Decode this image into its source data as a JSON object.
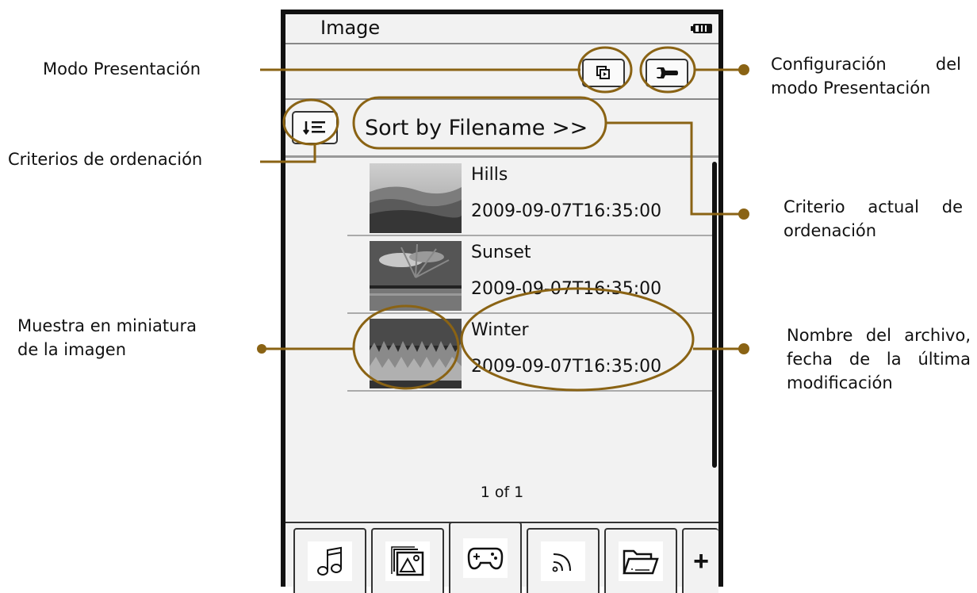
{
  "callouts": {
    "slideshow_mode": "Modo Presentación",
    "slideshow_config_line1": "Configuración del",
    "slideshow_config_line2": "modo Presentación",
    "sort_criteria": "Criterios de ordenación",
    "current_sort_line1": "Criterio actual de",
    "current_sort_line2": "ordenación",
    "thumbnail_line1": "Muestra en miniatura",
    "thumbnail_line2": "de la imagen",
    "filename_line1": "Nombre del archivo,",
    "filename_line2": "fecha de la última",
    "filename_line3": "modificación"
  },
  "device": {
    "title": "Image",
    "sort_label": "Sort by Filename >>",
    "pager": "1 of 1",
    "files": [
      {
        "name": "Hills",
        "date": "2009-09-07T16:35:00"
      },
      {
        "name": "Sunset",
        "date": "2009-09-07T16:35:00"
      },
      {
        "name": "Winter",
        "date": "2009-09-07T16:35:00"
      }
    ],
    "tabs": [
      {
        "icon": "music-note-icon"
      },
      {
        "icon": "image-icon"
      },
      {
        "icon": "gamepad-icon",
        "active": true
      },
      {
        "icon": "rss-feed-icon"
      },
      {
        "icon": "folder-icon"
      },
      {
        "icon": "plus-icon",
        "label": "+"
      }
    ]
  },
  "colors": {
    "annotation": "#8a6314",
    "device_bg": "#f2f2f2",
    "frame": "#111111"
  }
}
